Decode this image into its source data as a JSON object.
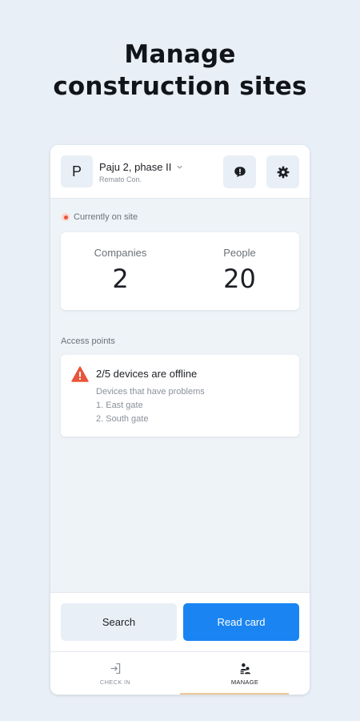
{
  "headline": {
    "line1": "Manage",
    "line2": "construction sites"
  },
  "site": {
    "avatar_letter": "P",
    "name": "Paju 2, phase II",
    "company": "Remato Con."
  },
  "header_icons": {
    "feedback": "chat-alert-icon",
    "settings": "gear-icon"
  },
  "status": {
    "label": "Currently on site",
    "color": "#e8553d"
  },
  "stats": {
    "companies_label": "Companies",
    "companies_value": "2",
    "people_label": "People",
    "people_value": "20"
  },
  "access_points": {
    "section_label": "Access points",
    "alert_title": "2/5 devices are offline",
    "alert_subtitle": "Devices that have problems",
    "items": [
      "1. East gate",
      "2. South gate"
    ],
    "alert_color": "#e8553d"
  },
  "actions": {
    "search_label": "Search",
    "read_card_label": "Read card",
    "accent_color": "#1a85f2"
  },
  "nav": {
    "check_in_label": "CHECK IN",
    "manage_label": "MANAGE",
    "active": "MANAGE"
  }
}
